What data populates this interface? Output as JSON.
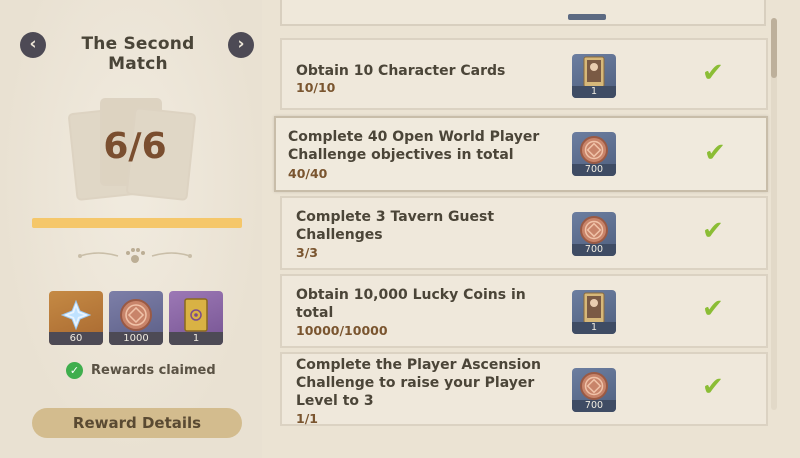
{
  "match": {
    "title": "The Second Match",
    "progress_text": "6/6",
    "progress_fraction": 1.0
  },
  "rewards": [
    {
      "name": "primogem-icon",
      "qty": "60",
      "color": "#b87b3c"
    },
    {
      "name": "lucky-coin-icon",
      "qty": "1000",
      "color": "#6c6d97"
    },
    {
      "name": "card-back-icon",
      "qty": "1",
      "color": "#8a68a6"
    }
  ],
  "status": {
    "claimed_text": "Rewards claimed"
  },
  "buttons": {
    "reward_details": "Reward Details"
  },
  "tasks": [
    {
      "title": "Obtain 10 Character Cards",
      "progress": "10/10",
      "reward_icon": "character-card-icon",
      "reward_qty": "1",
      "completed": true
    },
    {
      "title": "Complete 40 Open World Player Challenge objectives in total",
      "progress": "40/40",
      "reward_icon": "lucky-coin-icon",
      "reward_qty": "700",
      "completed": true
    },
    {
      "title": "Complete 3 Tavern Guest Challenges",
      "progress": "3/3",
      "reward_icon": "lucky-coin-icon",
      "reward_qty": "700",
      "completed": true
    },
    {
      "title": "Obtain 10,000 Lucky Coins in total",
      "progress": "10000/10000",
      "reward_icon": "character-card-icon",
      "reward_qty": "1",
      "completed": true
    },
    {
      "title": "Complete the Player Ascension Challenge to raise your Player Level to 3",
      "progress": "1/1",
      "reward_icon": "lucky-coin-icon",
      "reward_qty": "700",
      "completed": true
    }
  ],
  "colors": {
    "accent_gold": "#d3bc8e",
    "progress": "#f5c76a",
    "check_green": "#8bbd35",
    "claimed_green": "#3fae4d"
  }
}
